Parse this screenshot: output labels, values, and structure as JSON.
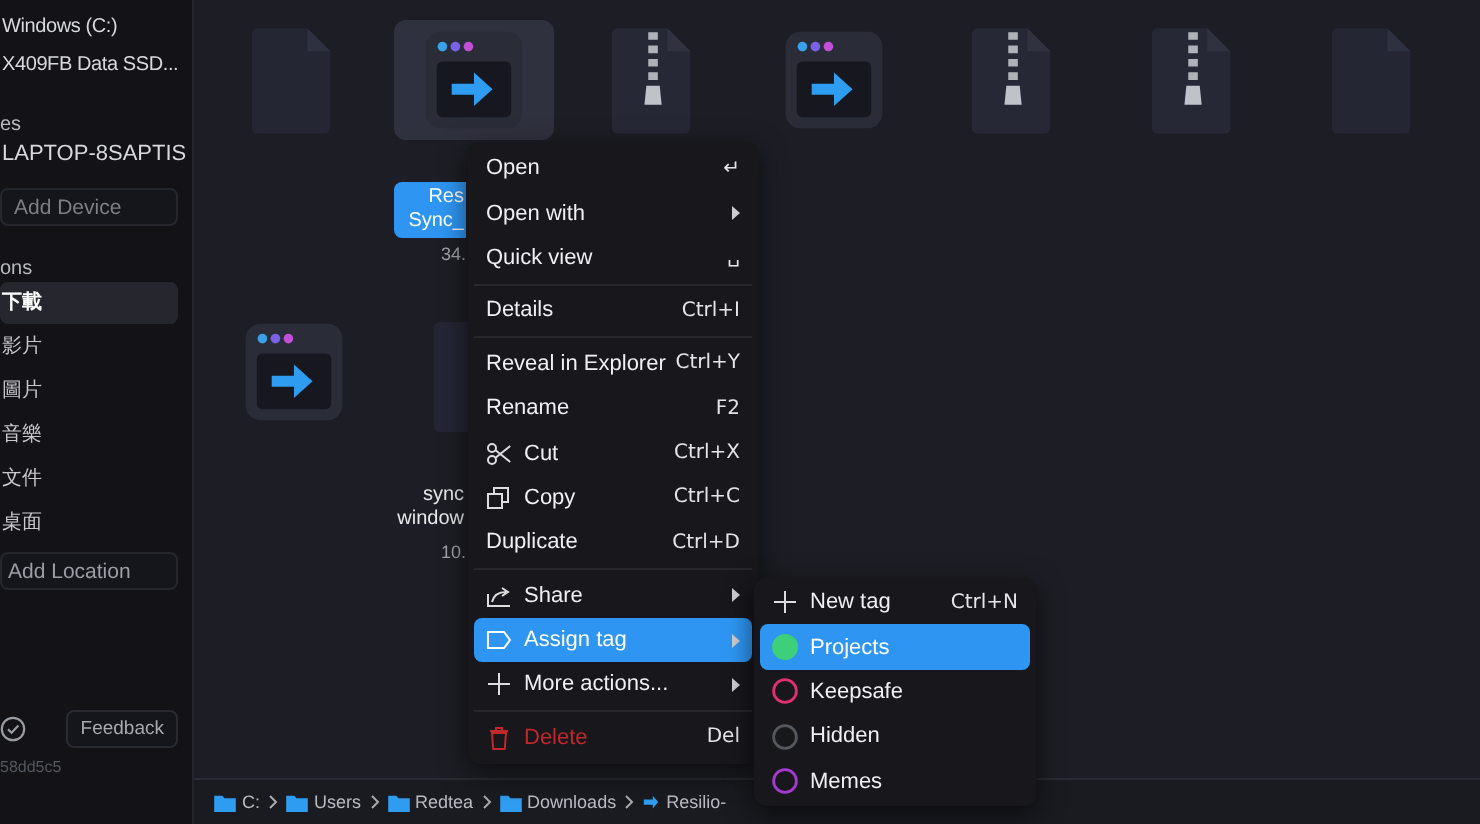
{
  "sidebar": {
    "drives": [
      "Windows (C:)",
      "X409FB Data SSD..."
    ],
    "devices_heading": "es",
    "devices": [
      "LAPTOP-8SAPTIS"
    ],
    "add_device": "Add Device",
    "locations_heading": "ons",
    "locations": [
      {
        "label": "下載",
        "selected": true
      },
      {
        "label": "影片",
        "selected": false
      },
      {
        "label": "圖片",
        "selected": false
      },
      {
        "label": "音樂",
        "selected": false
      },
      {
        "label": "文件",
        "selected": false
      },
      {
        "label": "桌面",
        "selected": false
      }
    ],
    "add_location": "Add Location",
    "feedback": "Feedback",
    "version": "58dd5c5"
  },
  "files": [
    {
      "kind": "document",
      "selected": false
    },
    {
      "kind": "app",
      "selected": true,
      "name_lines": [
        "Res",
        "Sync_"
      ],
      "size": "34."
    },
    {
      "kind": "zip",
      "selected": false
    },
    {
      "kind": "app",
      "selected": false
    },
    {
      "kind": "zip",
      "selected": false
    },
    {
      "kind": "zip",
      "selected": false
    },
    {
      "kind": "document",
      "selected": false
    },
    {
      "kind": "app",
      "selected": false
    },
    {
      "kind": "document",
      "selected": false,
      "name_lines": [
        "sync",
        "window"
      ],
      "size": "10."
    }
  ],
  "context_menu": [
    {
      "kind": "item",
      "label": "Open",
      "shortcut": "↵"
    },
    {
      "kind": "item",
      "label": "Open with",
      "submenu": true
    },
    {
      "kind": "item",
      "label": "Quick view",
      "shortcut": "␣"
    },
    {
      "kind": "separator"
    },
    {
      "kind": "item",
      "label": "Details",
      "shortcut": "Ctrl+I"
    },
    {
      "kind": "separator"
    },
    {
      "kind": "item",
      "label": "Reveal in Explorer",
      "shortcut": "Ctrl+Y"
    },
    {
      "kind": "item",
      "label": "Rename",
      "shortcut": "F2"
    },
    {
      "kind": "cut",
      "label": "Cut",
      "shortcut": "Ctrl+X"
    },
    {
      "kind": "copy",
      "label": "Copy",
      "shortcut": "Ctrl+C"
    },
    {
      "kind": "item",
      "label": "Duplicate",
      "shortcut": "Ctrl+D"
    },
    {
      "kind": "separator"
    },
    {
      "kind": "share",
      "label": "Share",
      "submenu": true
    },
    {
      "kind": "tag",
      "label": "Assign tag",
      "submenu": true,
      "selected": true
    },
    {
      "kind": "more",
      "label": "More actions...",
      "submenu": true
    },
    {
      "kind": "separator"
    },
    {
      "kind": "delete",
      "label": "Delete",
      "shortcut": "Del"
    }
  ],
  "tag_menu": {
    "new_tag": {
      "label": "New tag",
      "shortcut": "Ctrl+N"
    },
    "tags": [
      {
        "label": "Projects",
        "color": "#3ecf7a",
        "selected": true,
        "assigned": true
      },
      {
        "label": "Keepsafe",
        "color": "#e0306f",
        "selected": false,
        "assigned": false
      },
      {
        "label": "Hidden",
        "color": "#55575f",
        "selected": false,
        "assigned": false
      },
      {
        "label": "Memes",
        "color": "#a43ad0",
        "selected": false,
        "assigned": false
      }
    ]
  },
  "breadcrumb": [
    {
      "label": "C:",
      "kind": "folder"
    },
    {
      "label": "Users",
      "kind": "folder"
    },
    {
      "label": "Redtea",
      "kind": "folder"
    },
    {
      "label": "Downloads",
      "kind": "folder"
    },
    {
      "label": "Resilio-",
      "kind": "file"
    }
  ]
}
